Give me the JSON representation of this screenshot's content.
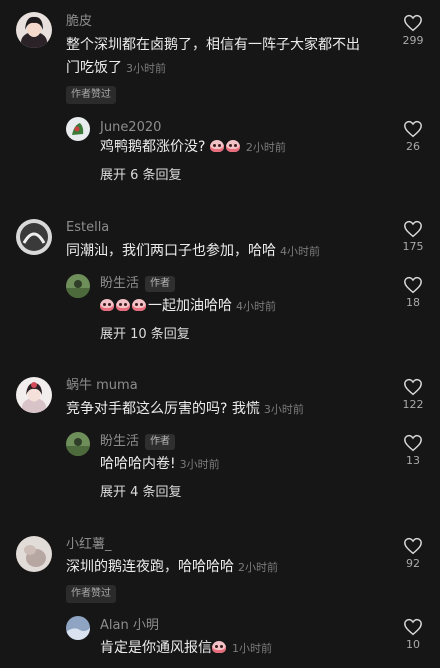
{
  "comments": [
    {
      "author": "脆皮",
      "text": "整个深圳都在卤鹅了，相信有一阵子大家都不出门吃饭了",
      "time": "3小时前",
      "likes": "299",
      "badge": "作者赞过",
      "reply": {
        "author": "June2020",
        "text": "鸡鸭鹅都涨价没?",
        "emoji_count": 2,
        "time": "2小时前",
        "likes": "26"
      },
      "expand": "展开 6 条回复"
    },
    {
      "author": "Estella",
      "text": "同潮汕，我们两口子也参加，哈哈",
      "time": "4小时前",
      "likes": "175",
      "reply": {
        "author": "盼生活",
        "tag": "作者",
        "emoji_count": 3,
        "text": "一起加油哈哈",
        "time": "4小时前",
        "likes": "18"
      },
      "expand": "展开 10 条回复"
    },
    {
      "author": "蜗牛 muma",
      "text": "竞争对手都这么厉害的吗? 我慌",
      "time": "3小时前",
      "likes": "122",
      "reply": {
        "author": "盼生活",
        "tag": "作者",
        "text": "哈哈哈内卷!",
        "time": "3小时前",
        "likes": "13"
      },
      "expand": "展开 4 条回复"
    },
    {
      "author": "小红薯_",
      "text": "深圳的鹅连夜跑，哈哈哈哈",
      "time": "2小时前",
      "likes": "92",
      "badge": "作者赞过",
      "reply": {
        "author": "Alan 小明",
        "text": "肯定是你通风报信",
        "emoji_count": 1,
        "time": "1小时前",
        "likes": "10"
      }
    }
  ],
  "icons": {
    "like": "heart-outline-icon",
    "emoji": "face-emoji-icon"
  },
  "colors": {
    "background": "#161616",
    "text": "#ececec",
    "muted": "#8d8d8d"
  }
}
